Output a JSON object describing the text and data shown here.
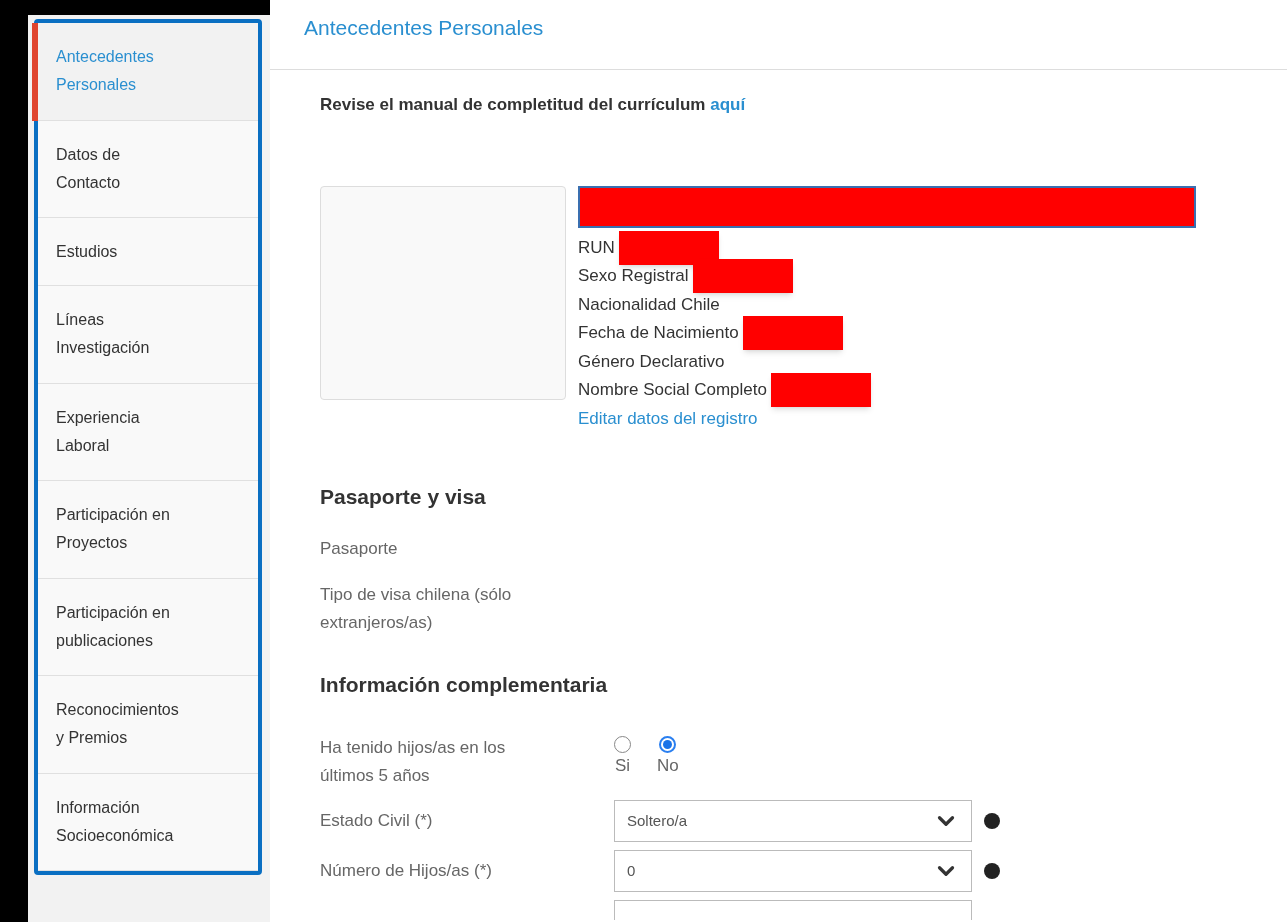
{
  "sidebar": {
    "items": [
      {
        "label": "Antecedentes Personales",
        "selected": true
      },
      {
        "label": "Datos de Contacto",
        "selected": false
      },
      {
        "label": "Estudios",
        "selected": false
      },
      {
        "label": "Líneas Investigación",
        "selected": false
      },
      {
        "label": "Experiencia Laboral",
        "selected": false
      },
      {
        "label": "Participación en Proyectos",
        "selected": false
      },
      {
        "label": "Participación en publicaciones",
        "selected": false
      },
      {
        "label": "Reconocimientos y Premios",
        "selected": false
      },
      {
        "label": "Información Socioeconómica",
        "selected": false
      }
    ]
  },
  "page_title": "Antecedentes Personales",
  "manual_notice": {
    "text": "Revise el manual de completitud del currículum",
    "link": "aquí"
  },
  "profile": {
    "fields": [
      {
        "label": "RUN",
        "redacted": true
      },
      {
        "label": "Sexo Registral",
        "redacted": true
      },
      {
        "label": "Nacionalidad Chile",
        "redacted": false
      },
      {
        "label": "Fecha de Nacimiento",
        "redacted": true
      },
      {
        "label": "Género Declarativo",
        "redacted": false
      },
      {
        "label": "Nombre Social Completo",
        "redacted": true
      }
    ],
    "edit_link": "Editar datos del registro"
  },
  "passport_section": {
    "title": "Pasaporte y visa",
    "fields": [
      "Pasaporte",
      "Tipo de visa chilena (sólo extranjeros/as)"
    ]
  },
  "complementary_section": {
    "title": "Información complementaria",
    "children_question": {
      "label": "Ha tenido hijos/as en los últimos 5 años",
      "options": [
        {
          "label": "Si",
          "selected": false
        },
        {
          "label": "No",
          "selected": true
        }
      ]
    },
    "selects": [
      {
        "label": "Estado Civil (*)",
        "value": "Soltero/a"
      },
      {
        "label": "Número de Hijos/as (*)",
        "value": "0"
      }
    ]
  }
}
